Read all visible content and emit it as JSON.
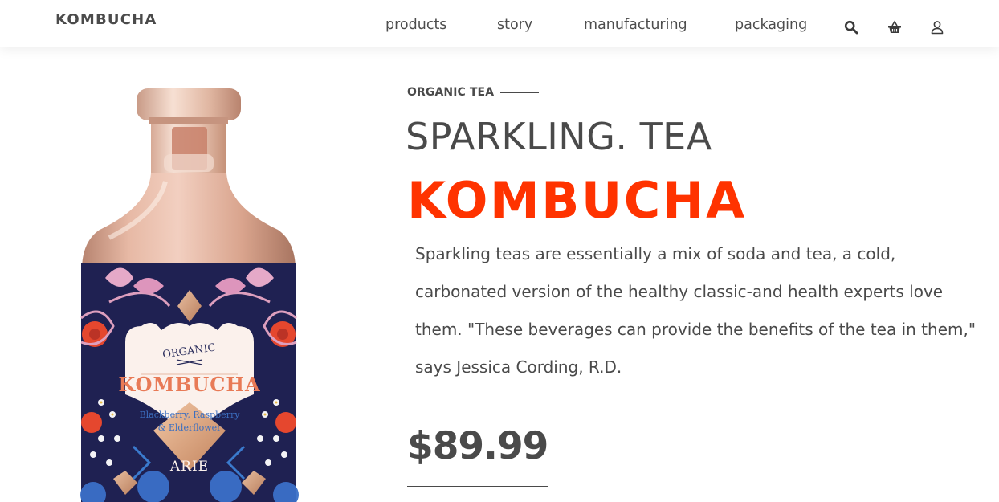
{
  "header": {
    "logo": "KOMBUCHA",
    "nav": [
      {
        "label": "products"
      },
      {
        "label": "story"
      },
      {
        "label": "manufacturing"
      },
      {
        "label": "packaging"
      }
    ],
    "icons": [
      "search-icon",
      "basket-icon",
      "user-icon"
    ]
  },
  "product": {
    "eyebrow": "ORGANIC TEA",
    "title": "SPARKLING. TEA",
    "brand": "KOMBUCHA",
    "description": "Sparkling teas are essentially a mix of soda and tea, a cold, carbonated version of the healthy classic-and health experts love them. \"These beverages can provide the benefits of the tea in them,\" says Jessica Cording, R.D.",
    "price": "$89.99",
    "label": {
      "arc_text": "ORGANIC",
      "name": "KOMBUCHA",
      "flavor_line1": "Blackberry, Raspberry",
      "flavor_line2": "& Elderflower",
      "maker": "ARIE"
    }
  },
  "colors": {
    "accent": "#ff3300",
    "text": "#4a4a4a",
    "bottle_navy": "#1f2152",
    "bottle_copper": "#d9a58e"
  }
}
